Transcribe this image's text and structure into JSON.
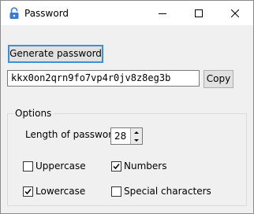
{
  "window": {
    "title": "Password"
  },
  "actions": {
    "generate_label": "Generate password",
    "copy_label": "Copy"
  },
  "password": {
    "value": "kkx0on2qrn9fo7vp4r0jv8z8eg3b"
  },
  "options": {
    "group_label": "Options",
    "length_label": "Length of password",
    "length_value": "28",
    "checkboxes": [
      {
        "label": "Uppercase",
        "checked": false
      },
      {
        "label": "Numbers",
        "checked": true
      },
      {
        "label": "Lowercase",
        "checked": true
      },
      {
        "label": "Special characters",
        "checked": false
      }
    ]
  }
}
